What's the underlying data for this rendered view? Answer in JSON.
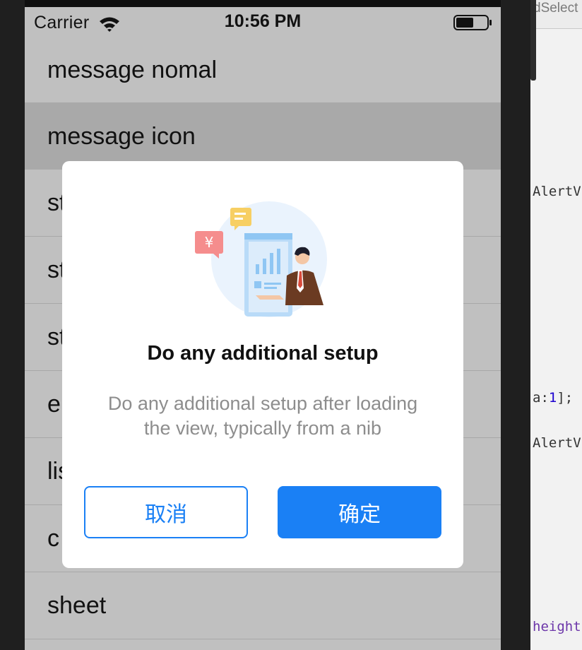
{
  "status_bar": {
    "carrier": "Carrier",
    "time": "10:56 PM"
  },
  "list": {
    "items": [
      {
        "label": "message nomal"
      },
      {
        "label": "message icon"
      },
      {
        "label": "st"
      },
      {
        "label": "st"
      },
      {
        "label": "st"
      },
      {
        "label": "e"
      },
      {
        "label": "lis"
      },
      {
        "label": "c"
      },
      {
        "label": "sheet"
      }
    ],
    "selected_index": 1
  },
  "dialog": {
    "title": "Do any additional setup",
    "message_line1": "Do any additional setup after loading",
    "message_line2": "the view, typically from a nib",
    "cancel_label": "取消",
    "confirm_label": "确定",
    "illustration_symbol": "¥"
  },
  "editor": {
    "tab_label": "dSelect",
    "code_lines": [
      {
        "text": "AlertV"
      },
      {
        "prefix": "a:",
        "num": "1",
        "suffix": "];"
      },
      {
        "text": "AlertV"
      },
      {
        "text": "height"
      }
    ]
  },
  "colors": {
    "accent": "#1a80f5",
    "list_background": "#c0c0c0",
    "selected_row": "#a9a9a9",
    "dialog_message": "#8d8d8d"
  }
}
